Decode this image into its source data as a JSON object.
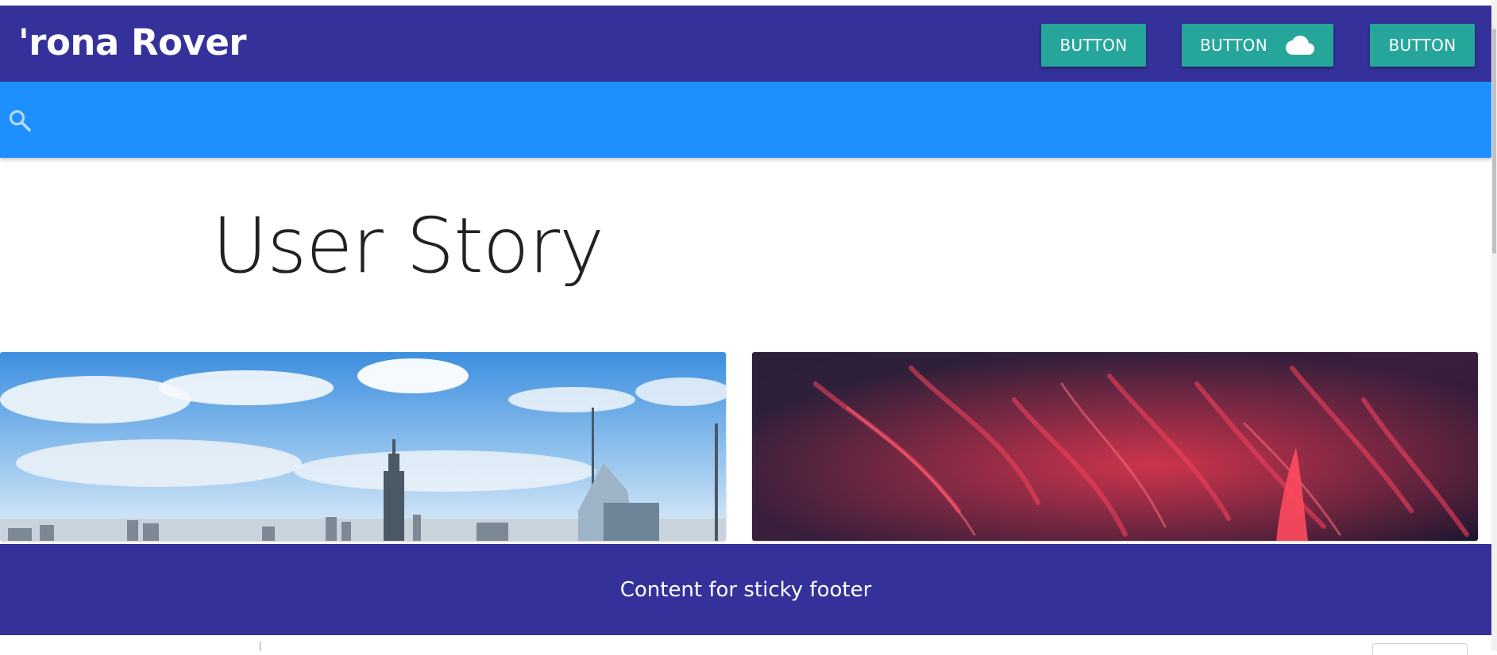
{
  "header": {
    "brand": "'rona Rover",
    "buttons": [
      {
        "label": "BUTTON",
        "icon": null
      },
      {
        "label": "BUTTON",
        "icon": "cloud-icon"
      },
      {
        "label": "BUTTON",
        "icon": null
      }
    ]
  },
  "search": {
    "icon": "search-icon"
  },
  "main": {
    "title": "User Story",
    "cards": [
      {
        "image": "city-skyline-image"
      },
      {
        "image": "red-clouds-image"
      }
    ]
  },
  "footer": {
    "text": "Content for sticky footer"
  },
  "colors": {
    "header_bg": "#35319a",
    "search_bg": "#1e8fff",
    "button_bg": "#26a69a",
    "footer_bg": "#35319a"
  }
}
